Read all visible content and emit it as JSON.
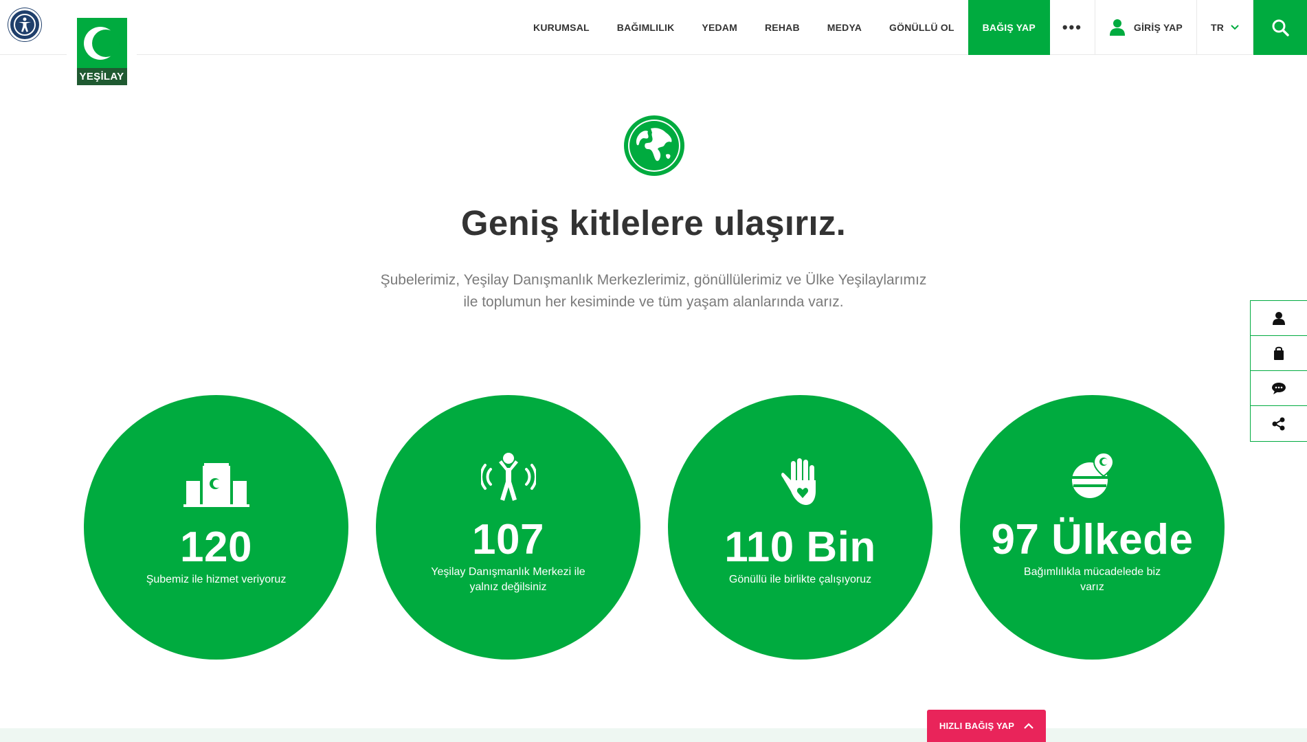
{
  "header": {
    "logo_text": "YEŞİLAY",
    "nav": [
      {
        "label": "KURUMSAL"
      },
      {
        "label": "BAĞIMLILIK"
      },
      {
        "label": "YEDAM"
      },
      {
        "label": "REHAB"
      },
      {
        "label": "MEDYA"
      },
      {
        "label": "GÖNÜLLÜ OL"
      }
    ],
    "donate_label": "BAĞIŞ YAP",
    "more_label": "•••",
    "login_label": "GİRİŞ YAP",
    "lang_label": "TR",
    "icons": {
      "accessibility": "accessibility-icon",
      "user": "user-icon",
      "chevron": "chevron-down-icon",
      "search": "search-icon"
    }
  },
  "hero": {
    "icon": "globe-icon",
    "title": "Geniş kitlelere ulaşırız.",
    "subtitle_line1": "Şubelerimiz, Yeşilay Danışmanlık Merkezlerimiz, gönüllülerimiz ve Ülke Yeşilaylarımız",
    "subtitle_line2": "ile toplumun her kesiminde ve tüm yaşam alanlarında varız."
  },
  "stats": [
    {
      "icon": "branch-buildings-icon",
      "value": "120",
      "caption_line1": "Şubemiz ile hizmet veriyoruz",
      "caption_line2": ""
    },
    {
      "icon": "person-support-icon",
      "value": "107",
      "caption_line1": "Yeşilay Danışmanlık Merkezi ile",
      "caption_line2": "yalnız değilsiniz"
    },
    {
      "icon": "hand-heart-icon",
      "value": "110 Bin",
      "caption_line1": "Gönüllü ile birlikte çalışıyoruz",
      "caption_line2": ""
    },
    {
      "icon": "globe-location-icon",
      "value": "97 Ülkede",
      "caption_line1": "Bağımlılıkla mücadelede biz",
      "caption_line2": "varız"
    }
  ],
  "side_buttons": [
    "user-icon",
    "shopping-bag-icon",
    "chat-icon",
    "share-icon"
  ],
  "quick_donate": {
    "label": "HIZLI BAĞIŞ YAP",
    "icon": "chevron-up-icon"
  },
  "colors": {
    "brand_green": "#00ab3f",
    "dark_green": "#1f5a31",
    "accent_pink": "#e9245a",
    "a11y_blue": "#1f3f6b"
  }
}
